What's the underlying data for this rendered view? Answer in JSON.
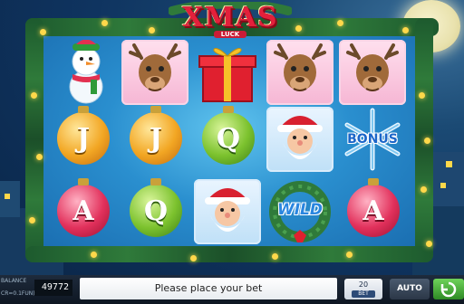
{
  "game": {
    "logo_text": "XMAS",
    "logo_subtext": "LUCK"
  },
  "reels": [
    [
      {
        "symbol": "snowman"
      },
      {
        "symbol": "J"
      },
      {
        "symbol": "A"
      }
    ],
    [
      {
        "symbol": "reindeer"
      },
      {
        "symbol": "J"
      },
      {
        "symbol": "Q"
      }
    ],
    [
      {
        "symbol": "gift"
      },
      {
        "symbol": "Q"
      },
      {
        "symbol": "santa"
      }
    ],
    [
      {
        "symbol": "reindeer"
      },
      {
        "symbol": "santa"
      },
      {
        "symbol": "WILD"
      }
    ],
    [
      {
        "symbol": "reindeer"
      },
      {
        "symbol": "BONUS"
      },
      {
        "symbol": "A"
      }
    ]
  ],
  "symbols": {
    "J": "J",
    "Q": "Q",
    "A": "A",
    "wild": "WILD",
    "bonus": "BONUS"
  },
  "bottom_bar": {
    "balance_label": "BALANCE",
    "balance_value": "49772",
    "credit_label": "CR=0.1FUN)",
    "message": "Please place your bet",
    "bet_value": "20",
    "bet_label": "BET",
    "auto_label": "AUTO"
  },
  "colors": {
    "reel_background": "#2a8fcf",
    "garland": "#2f7a3a",
    "lights": "#ffd84a",
    "spin_button": "#3ea52f",
    "message_bg": "#ffffff"
  }
}
